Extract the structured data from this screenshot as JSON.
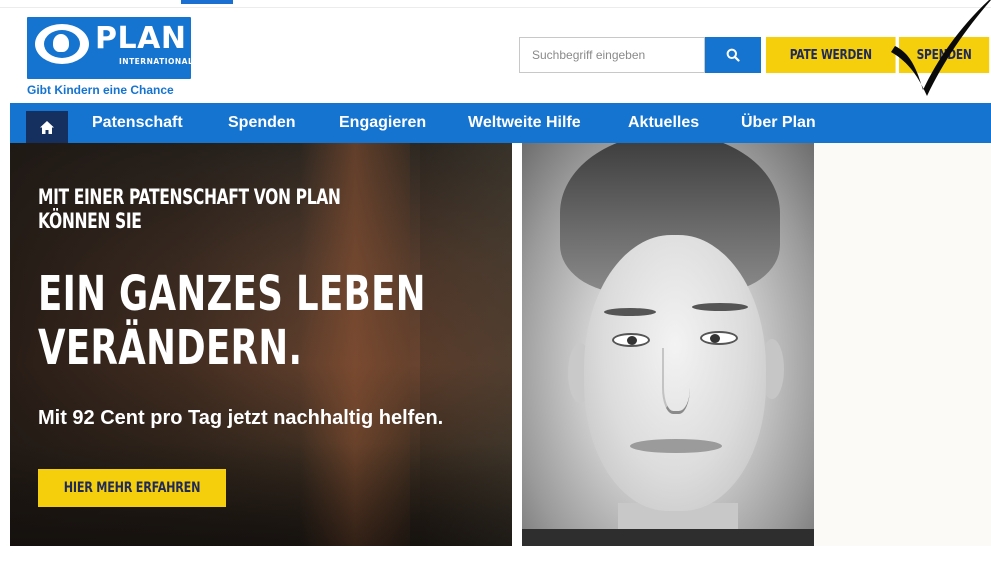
{
  "header": {
    "logo_word": "PLAN",
    "logo_sub": "INTERNATIONAL",
    "tagline": "Gibt Kindern eine Chance",
    "search_placeholder": "Suchbegriff eingeben",
    "search_icon": "search-icon",
    "cta_pate": "PATE WERDEN",
    "cta_spenden": "SPENDEN"
  },
  "nav": {
    "home_icon": "home-icon",
    "items": [
      {
        "label": "Patenschaft"
      },
      {
        "label": "Spenden"
      },
      {
        "label": "Engagieren"
      },
      {
        "label": "Weltweite Hilfe"
      },
      {
        "label": "Aktuelles"
      },
      {
        "label": "Über Plan"
      }
    ]
  },
  "hero": {
    "kicker_line1": "MIT EINER PATENSCHAFT VON PLAN",
    "kicker_line2": "KÖNNEN SIE",
    "headline_line1": "EIN GANZES LEBEN",
    "headline_line2": "VERÄNDERN.",
    "sub": "Mit 92 Cent pro Tag jetzt nachhaltig helfen.",
    "cta": "HIER MEHR ERFAHREN"
  },
  "overlay": {
    "checkmark_icon": "checkmark-icon"
  },
  "colors": {
    "brand_blue": "#1574d0",
    "nav_home_dark": "#15305e",
    "cta_yellow": "#f6cf0c",
    "cta_text": "#1f2a5a"
  }
}
